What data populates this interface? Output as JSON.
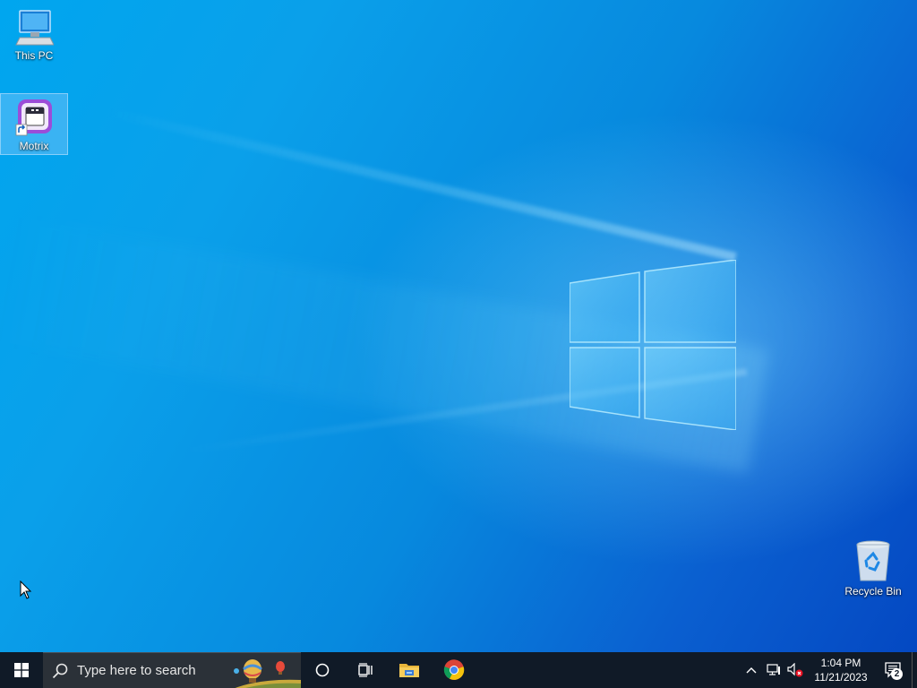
{
  "desktop": {
    "icons": [
      {
        "label": "This PC",
        "icon": "computer-icon"
      },
      {
        "label": "Motrix",
        "icon": "motrix-app-icon"
      },
      {
        "label": "Recycle Bin",
        "icon": "recycle-bin-icon"
      }
    ]
  },
  "taskbar": {
    "search": {
      "placeholder": "Type here to search"
    },
    "pinned_apps": [
      {
        "name": "File Explorer",
        "icon": "folder-icon"
      },
      {
        "name": "Google Chrome",
        "icon": "chrome-icon"
      }
    ],
    "tray": {
      "time": "1:04 PM",
      "date": "11/21/2023",
      "notifications_count": "2"
    }
  },
  "colors": {
    "taskbar_bg": "#101a27",
    "search_bg": "#2b3138",
    "desktop_accent": "#0a8ee6"
  }
}
